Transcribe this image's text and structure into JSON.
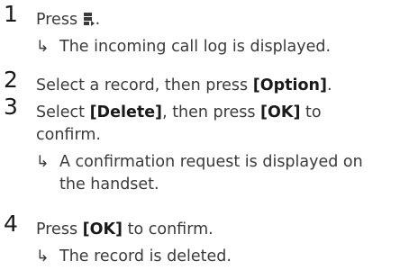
{
  "steps": [
    {
      "number": "1",
      "pre": "Press ",
      "icon": "call-log-icon",
      "post": ".",
      "result": "The incoming call log is displayed."
    },
    {
      "number": "2",
      "pre": "Select a record, then press ",
      "key": "[Option]",
      "post": "."
    },
    {
      "number": "3",
      "line1_pre": "Select ",
      "key1": "[Delete]",
      "line1_mid": ", then press ",
      "key2": "[OK]",
      "line1_post": " to",
      "line2": "confirm.",
      "result_line1": "A confirmation request is displayed on",
      "result_line2": "the handset."
    },
    {
      "number": "4",
      "pre": "Press ",
      "key": "[OK]",
      "post": " to confirm.",
      "result": "The record is deleted."
    }
  ],
  "arrow_glyph": "↳"
}
